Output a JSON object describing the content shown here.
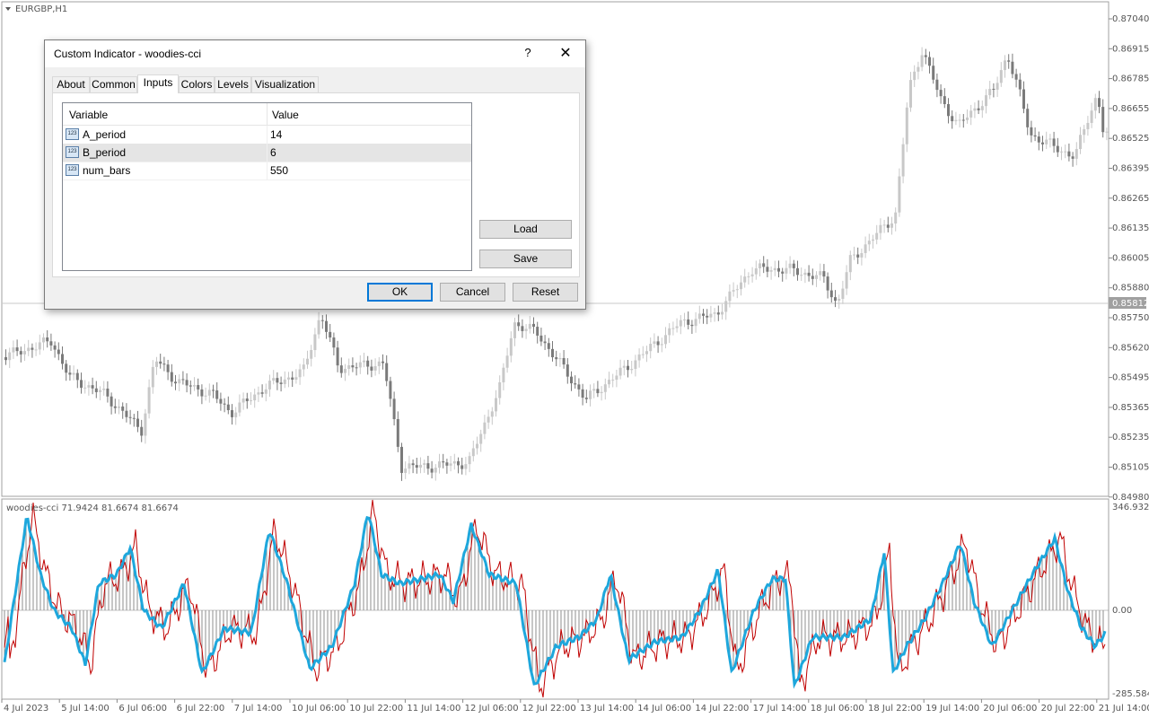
{
  "chart": {
    "symbol_label": "EURGBP,H1",
    "price_axis": [
      "0.87040",
      "0.86915",
      "0.86785",
      "0.86655",
      "0.86525",
      "0.86395",
      "0.86265",
      "0.86135",
      "0.86005",
      "0.85880",
      "0.85750",
      "0.85620",
      "0.85495",
      "0.85365",
      "0.85235",
      "0.85105",
      "0.84980"
    ],
    "current_price": "0.85812",
    "indicator_label": "woodies-cci 71.9424 81.6674 81.6674",
    "indicator_axis": {
      "top": "346.9324",
      "zero": "0.00",
      "bottom": "-285.5848"
    },
    "time_axis": [
      "4 Jul 2023",
      "5 Jul 14:00",
      "6 Jul 06:00",
      "6 Jul 22:00",
      "7 Jul 14:00",
      "10 Jul 06:00",
      "10 Jul 22:00",
      "11 Jul 14:00",
      "12 Jul 06:00",
      "12 Jul 22:00",
      "13 Jul 14:00",
      "14 Jul 06:00",
      "14 Jul 22:00",
      "17 Jul 14:00",
      "18 Jul 06:00",
      "18 Jul 22:00",
      "19 Jul 14:00",
      "20 Jul 06:00",
      "20 Jul 22:00",
      "21 Jul 14:00"
    ],
    "colors": {
      "cci_main": "#1ea7dc",
      "cci_signal": "#c00000",
      "bull_candle": "#c8c8c8",
      "bear_candle": "#7a7a7a",
      "histogram": "#444444"
    }
  },
  "dialog": {
    "title": "Custom Indicator - woodies-cci",
    "help_label": "?",
    "close_label": "✕",
    "tabs": [
      {
        "label": "About",
        "active": false
      },
      {
        "label": "Common",
        "active": false
      },
      {
        "label": "Inputs",
        "active": true
      },
      {
        "label": "Colors",
        "active": false
      },
      {
        "label": "Levels",
        "active": false
      },
      {
        "label": "Visualization",
        "active": false
      }
    ],
    "grid": {
      "headers": {
        "variable": "Variable",
        "value": "Value"
      },
      "rows": [
        {
          "name": "A_period",
          "value": "14",
          "icon": "int-icon",
          "selected": false
        },
        {
          "name": "B_period",
          "value": "6",
          "icon": "int-icon",
          "selected": true
        },
        {
          "name": "num_bars",
          "value": "550",
          "icon": "int-icon",
          "selected": false
        }
      ],
      "icon_text": "123"
    },
    "load_label": "Load",
    "save_label": "Save",
    "ok_label": "OK",
    "cancel_label": "Cancel",
    "reset_label": "Reset"
  }
}
